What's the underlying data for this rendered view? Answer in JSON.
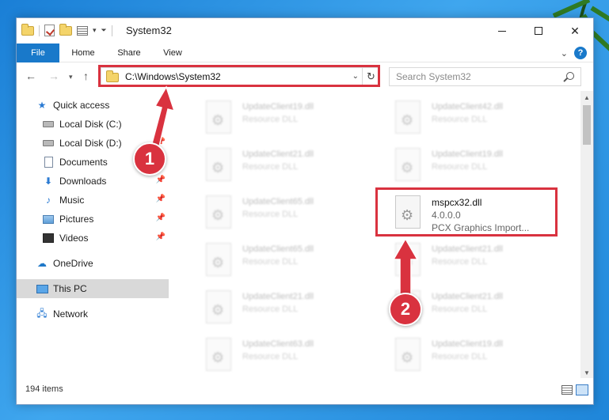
{
  "window": {
    "title": "System32",
    "tabs": {
      "file": "File",
      "home": "Home",
      "share": "Share",
      "view": "View"
    },
    "help_label": "?"
  },
  "nav": {
    "address": "C:\\Windows\\System32",
    "search_placeholder": "Search System32"
  },
  "sidebar": {
    "items": [
      {
        "label": "Quick access",
        "icon": "star-icon"
      },
      {
        "label": "Local Disk (C:)",
        "icon": "drive-icon",
        "pinned": true
      },
      {
        "label": "Local Disk (D:)",
        "icon": "drive-icon",
        "pinned": true
      },
      {
        "label": "Documents",
        "icon": "documents-icon",
        "pinned": true
      },
      {
        "label": "Downloads",
        "icon": "download-icon",
        "pinned": true
      },
      {
        "label": "Music",
        "icon": "music-icon",
        "pinned": true
      },
      {
        "label": "Pictures",
        "icon": "pictures-icon",
        "pinned": true
      },
      {
        "label": "Videos",
        "icon": "videos-icon",
        "pinned": true
      },
      {
        "label": "OneDrive",
        "icon": "cloud-icon"
      },
      {
        "label": "This PC",
        "icon": "computer-icon",
        "selected": true
      },
      {
        "label": "Network",
        "icon": "network-icon"
      }
    ]
  },
  "files": {
    "left": [
      {
        "name": "UpdateClient19.dll",
        "desc": "Resource DLL"
      },
      {
        "name": "UpdateClient21.dll",
        "desc": "Resource DLL"
      },
      {
        "name": "UpdateClient65.dll",
        "desc": "Resource DLL"
      },
      {
        "name": "UpdateClient65.dll",
        "desc": "Resource DLL"
      },
      {
        "name": "UpdateClient21.dll",
        "desc": "Resource DLL"
      },
      {
        "name": "UpdateClient63.dll",
        "desc": "Resource DLL"
      }
    ],
    "right": [
      {
        "name": "UpdateClient42.dll",
        "desc": "Resource DLL"
      },
      {
        "name": "UpdateClient19.dll",
        "desc": "Resource DLL"
      },
      {
        "name": "mspcx32.dll",
        "desc": "4.0.0.0",
        "desc2": "PCX Graphics Import...",
        "target": true
      },
      {
        "name": "UpdateClient21.dll",
        "desc": "Resource DLL"
      },
      {
        "name": "UpdateClient21.dll",
        "desc": "Resource DLL"
      },
      {
        "name": "UpdateClient19.dll",
        "desc": "Resource DLL"
      }
    ]
  },
  "status": {
    "item_count": "194 items"
  },
  "annotations": {
    "step1": "1",
    "step2": "2",
    "color": "#d9323f"
  }
}
